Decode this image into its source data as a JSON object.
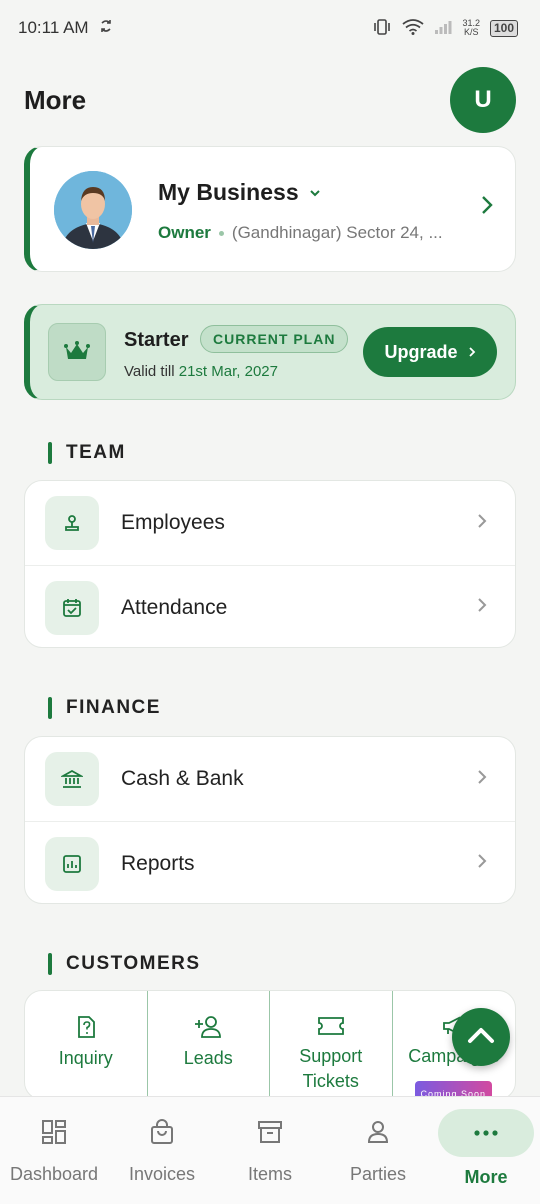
{
  "status_bar": {
    "time": "10:11 AM",
    "net_speed_top": "31.2",
    "net_speed_unit": "K/S",
    "battery": "100"
  },
  "header": {
    "title": "More",
    "avatar_initial": "U"
  },
  "business": {
    "name": "My Business",
    "role": "Owner",
    "address": "(Gandhinagar) Sector 24, ..."
  },
  "plan": {
    "name": "Starter",
    "badge": "CURRENT PLAN",
    "valid_prefix": "Valid till",
    "valid_date": "21st Mar, 2027",
    "upgrade_label": "Upgrade"
  },
  "sections": {
    "team": {
      "title": "TEAM",
      "items": [
        {
          "label": "Employees"
        },
        {
          "label": "Attendance"
        }
      ]
    },
    "finance": {
      "title": "FINANCE",
      "items": [
        {
          "label": "Cash & Bank"
        },
        {
          "label": "Reports"
        }
      ]
    },
    "customers": {
      "title": "CUSTOMERS",
      "items": [
        {
          "label": "Inquiry"
        },
        {
          "label": "Leads"
        },
        {
          "label": "Support Tickets"
        },
        {
          "label": "Campaigns",
          "badge": "Coming Soon"
        }
      ]
    }
  },
  "bottom_nav": [
    {
      "label": "Dashboard",
      "icon": "dashboard-icon"
    },
    {
      "label": "Invoices",
      "icon": "bag-icon"
    },
    {
      "label": "Items",
      "icon": "archive-icon"
    },
    {
      "label": "Parties",
      "icon": "person-icon"
    },
    {
      "label": "More",
      "icon": "more-icon",
      "active": true
    }
  ],
  "colors": {
    "brand": "#1d7a3e",
    "brand_light": "#d9ecdd",
    "background": "#f4f5f3"
  }
}
